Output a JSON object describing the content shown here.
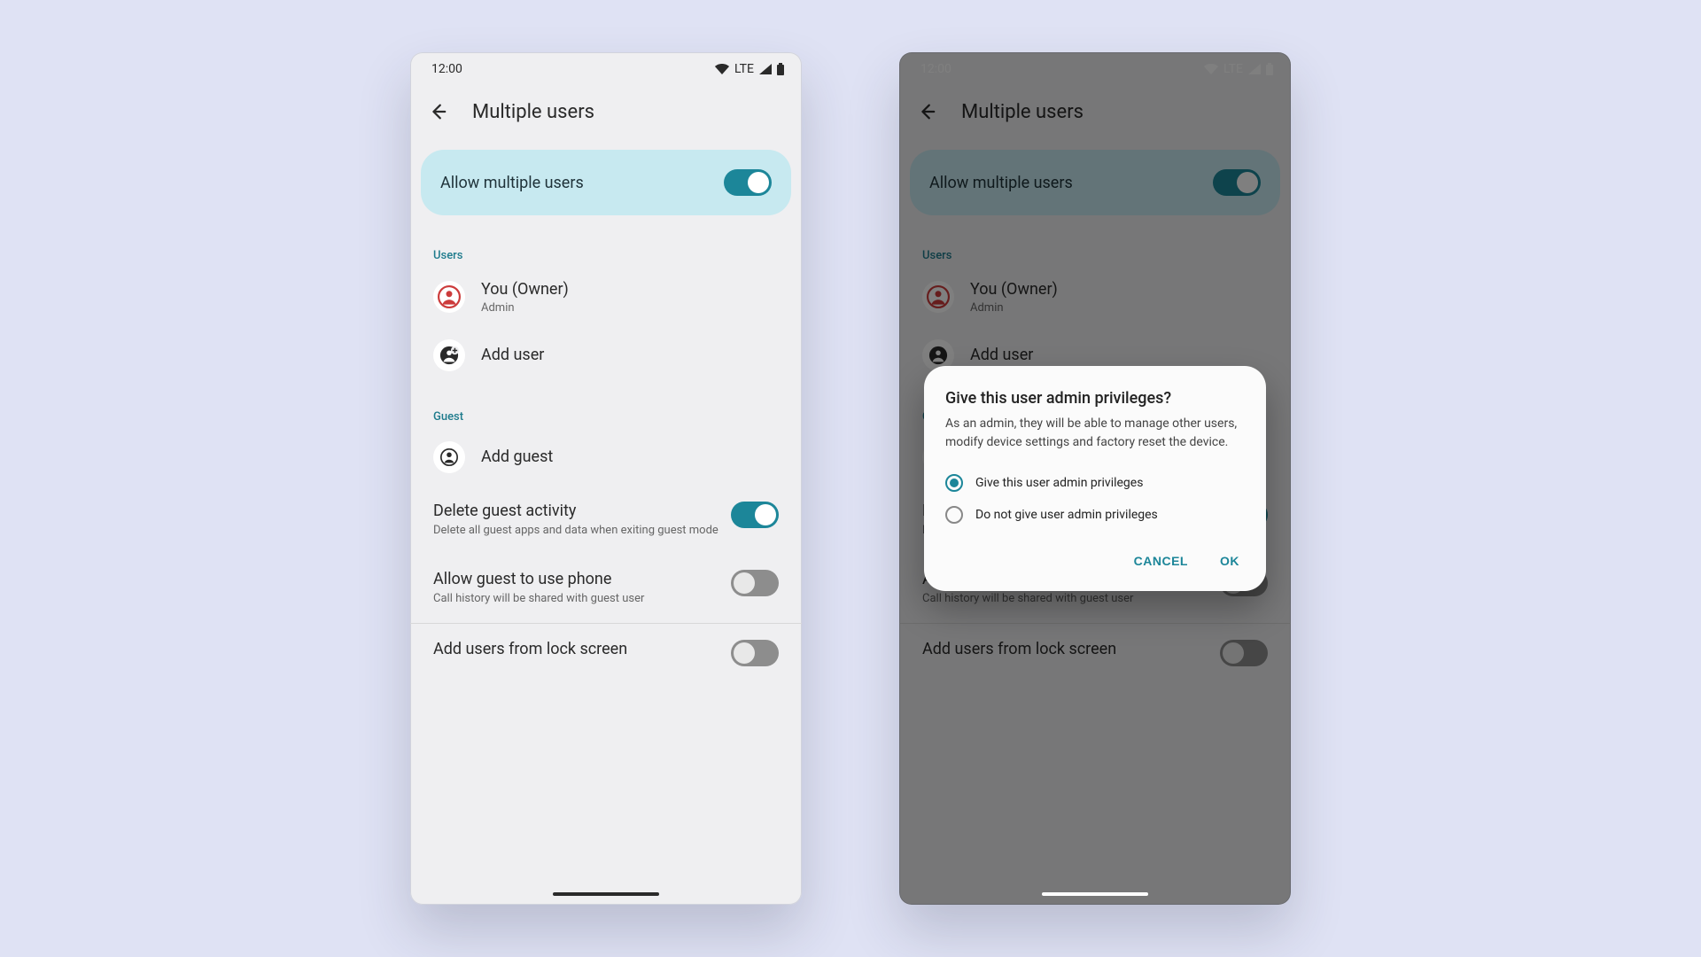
{
  "colors": {
    "accent": "#1c8699",
    "highlight": "#c7e9f0",
    "bg": "#efeff1"
  },
  "status": {
    "time": "12:00",
    "network": "LTE"
  },
  "appbar": {
    "title": "Multiple users"
  },
  "main_toggle": {
    "label": "Allow multiple users",
    "on": true
  },
  "sections": {
    "users_label": "Users",
    "guest_label": "Guest"
  },
  "users": {
    "owner": {
      "name": "You (Owner)",
      "role": "Admin"
    },
    "add_user": "Add user",
    "add_guest": "Add guest"
  },
  "settings": {
    "delete_guest": {
      "title": "Delete guest activity",
      "sub": "Delete all guest apps and data when exiting guest mode",
      "on": true
    },
    "guest_phone": {
      "title": "Allow guest to use phone",
      "sub": "Call history will be shared with guest user",
      "on": false
    },
    "lock_screen": {
      "title": "Add users from lock screen",
      "on": false
    }
  },
  "dialog": {
    "title": "Give this user admin privileges?",
    "body": "As an admin, they will be able to manage other users, modify device settings and factory reset the device.",
    "option_yes": "Give this user admin privileges",
    "option_no": "Do not give user admin privileges",
    "selected": "yes",
    "cancel": "CANCEL",
    "ok": "OK"
  }
}
